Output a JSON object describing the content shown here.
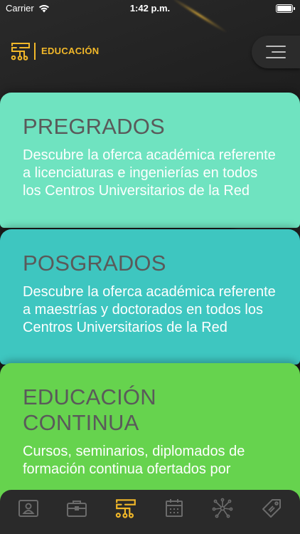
{
  "status_bar": {
    "carrier": "Carrier",
    "time": "1:42 p.m."
  },
  "header": {
    "brand": "EDUCACIÓN",
    "accent_color": "#f2b829"
  },
  "cards": [
    {
      "title": "PREGRADOS",
      "description": "Descubre la oferca académica referente a licenciaturas e ingenierías en todos los Centros Universitarios de la Red",
      "color": "#6fe3c0"
    },
    {
      "title": "POSGRADOS",
      "description": "Descubre la oferca académica referente a maestrías y doctorados en todos los Centros Universitarios de la Red",
      "color": "#3ec6c0"
    },
    {
      "title": "EDUCACIÓN CONTINUA",
      "description": "Cursos, seminarios, diplomados de formación continua ofertados por",
      "color": "#66d34e"
    }
  ],
  "tabbar": {
    "icons": [
      "id-card-icon",
      "briefcase-icon",
      "education-circuit-icon",
      "calendar-icon",
      "network-icon",
      "tag-icon"
    ],
    "active_index": 2,
    "active_color": "#f2b829",
    "inactive_color": "#6b6b6b"
  }
}
